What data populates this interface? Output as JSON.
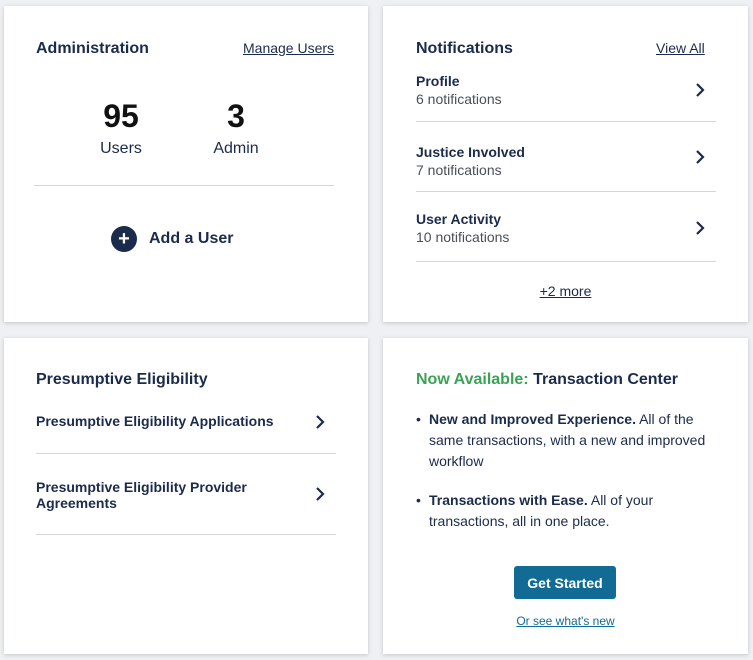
{
  "administration": {
    "title": "Administration",
    "manage_link": "Manage Users",
    "stats": [
      {
        "value": "95",
        "label": "Users"
      },
      {
        "value": "3",
        "label": "Admin"
      }
    ],
    "add_user_label": "Add a User"
  },
  "notifications": {
    "title": "Notifications",
    "view_all_link": "View All",
    "items": [
      {
        "title": "Profile",
        "count_text": "6 notifications"
      },
      {
        "title": "Justice Involved",
        "count_text": "7 notifications"
      },
      {
        "title": "User Activity",
        "count_text": "10 notifications"
      }
    ],
    "more_link": "+2 more"
  },
  "presumptive_eligibility": {
    "title": "Presumptive Eligibility",
    "items": [
      {
        "label": "Presumptive Eligibility Applications"
      },
      {
        "label": "Presumptive Eligibility Provider Agreements"
      }
    ]
  },
  "transaction_center": {
    "title_accent": "Now Available:",
    "title_main": "Transaction Center",
    "bullets": [
      {
        "bold": "New and Improved Experience.",
        "text": "All of the same transactions, with a new and improved workflow"
      },
      {
        "bold": "Transactions with Ease.",
        "text": "All of your transactions, all in one place."
      }
    ],
    "button_label": "Get Started",
    "secondary_link": "Or see what's new"
  },
  "colors": {
    "navy": "#1b2b4b",
    "accent_green": "#3aa356",
    "button_blue": "#126b95"
  },
  "icons": {
    "add": "plus-circle-icon",
    "row": "chevron-right-icon"
  }
}
